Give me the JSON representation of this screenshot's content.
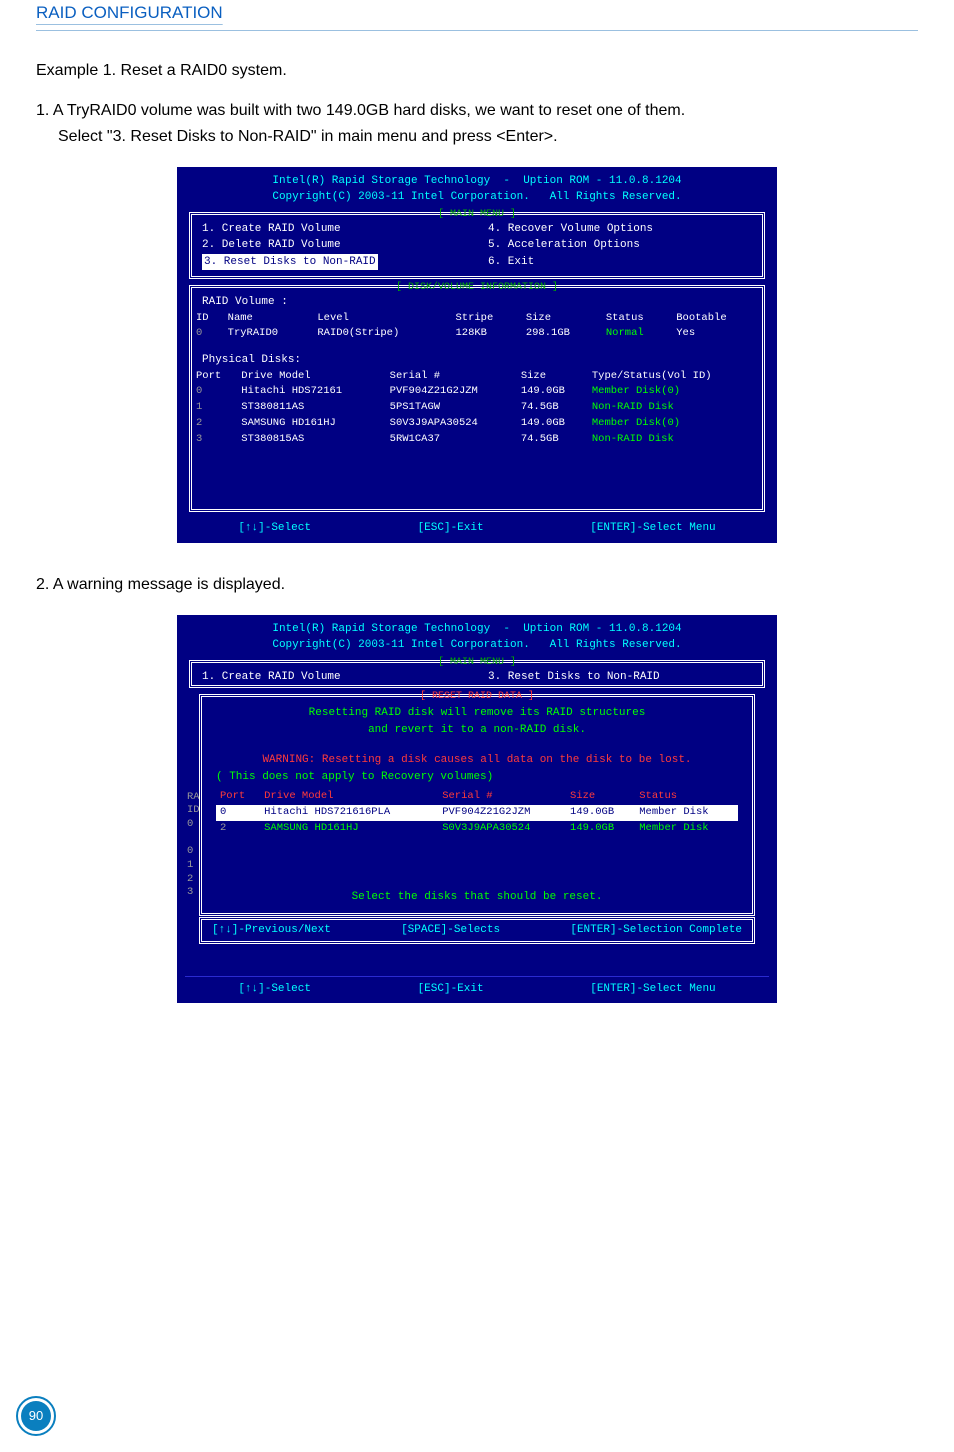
{
  "header": {
    "title": "RAID CONFIGURATION"
  },
  "intro": {
    "example": "Example 1. Reset a RAID0 system.",
    "step1a": "1. A TryRAID0 volume was built with two 149.0GB hard disks, we want to reset one of them.",
    "step1b": "Select \"3. Reset Disks to Non-RAID\" in main menu and press <Enter>."
  },
  "panel1": {
    "title1": "Intel(R) Rapid Storage Technology  -  Uption ROM - 11.0.8.1204",
    "title2": "Copyright(C) 2003-11 Intel Corporation.   All Rights Reserved.",
    "main_menu_label": "[ MAIN MENU ]",
    "menu_left": [
      "1. Create RAID Volume",
      "2. Delete RAID Volume",
      "3. Reset Disks to Non-RAID"
    ],
    "menu_right": [
      "4. Recover Volume Options",
      "5. Acceleration Options",
      "6. Exit"
    ],
    "disk_info_label": "[ DISK/VOLUME INFORMATION ]",
    "raid_volume_label": "RAID Volume :",
    "raid_headers": [
      "ID",
      "Name",
      "Level",
      "Stripe",
      "Size",
      "Status",
      "Bootable"
    ],
    "raid_rows": [
      [
        "0",
        "TryRAID0",
        "RAID0(Stripe)",
        "128KB",
        "298.1GB",
        "Normal",
        "Yes"
      ]
    ],
    "phys_label": "Physical Disks:",
    "phys_headers": [
      "Port",
      "Drive Model",
      "Serial #",
      "Size",
      "Type/Status(Vol ID)"
    ],
    "phys_rows": [
      [
        "0",
        "Hitachi HDS72161",
        "PVF904Z21G2JZM",
        "149.0GB",
        "Member Disk(0)"
      ],
      [
        "1",
        "ST380811AS",
        "5PS1TAGW",
        "74.5GB",
        "Non-RAID Disk"
      ],
      [
        "2",
        "SAMSUNG HD161HJ",
        "S0V3J9APA30524",
        "149.0GB",
        "Member Disk(0)"
      ],
      [
        "3",
        "ST380815AS",
        "5RW1CA37",
        "74.5GB",
        "Non-RAID Disk"
      ]
    ],
    "footer": [
      "[↑↓]-Select",
      "[ESC]-Exit",
      "[ENTER]-Select Menu"
    ]
  },
  "mid": {
    "step2": "2. A warning message is displayed."
  },
  "panel2": {
    "title1": "Intel(R) Rapid Storage Technology  -  Uption ROM - 11.0.8.1204",
    "title2": "Copyright(C) 2003-11 Intel Corporation.   All Rights Reserved.",
    "main_menu_label": "[ MAIN MENU ]",
    "menu_left": "1. Create RAID Volume",
    "menu_right": "3. Reset Disks to Non-RAID",
    "reset_label": "[ RESET RAID DATA ]",
    "reset_line1": "Resetting RAID disk will remove its RAID structures",
    "reset_line2": "and revert it to a non-RAID disk.",
    "warn": "WARNING: Resetting a disk causes all data on the disk to be lost.",
    "note": "( This does not apply to Recovery volumes)",
    "reset_headers": [
      "Port",
      "Drive Model",
      "Serial #",
      "Size",
      "Status"
    ],
    "reset_rows": [
      [
        "0",
        "Hitachi HDS721616PLA",
        "PVF904Z21G2JZM",
        "149.0GB",
        "Member Disk"
      ],
      [
        "2",
        "SAMSUNG HD161HJ",
        "S0V3J9APA30524",
        "149.0GB",
        "Member Disk"
      ]
    ],
    "select_prompt": "Select the disks that should be reset.",
    "inner_footer": [
      "[↑↓]-Previous/Next",
      "[SPACE]-Selects",
      "[ENTER]-Selection Complete"
    ],
    "left_side": "RA\nID\n0\n\n0\n1\n2\n3",
    "footer": [
      "[↑↓]-Select",
      "[ESC]-Exit",
      "[ENTER]-Select Menu"
    ]
  },
  "page": {
    "number": "90"
  }
}
